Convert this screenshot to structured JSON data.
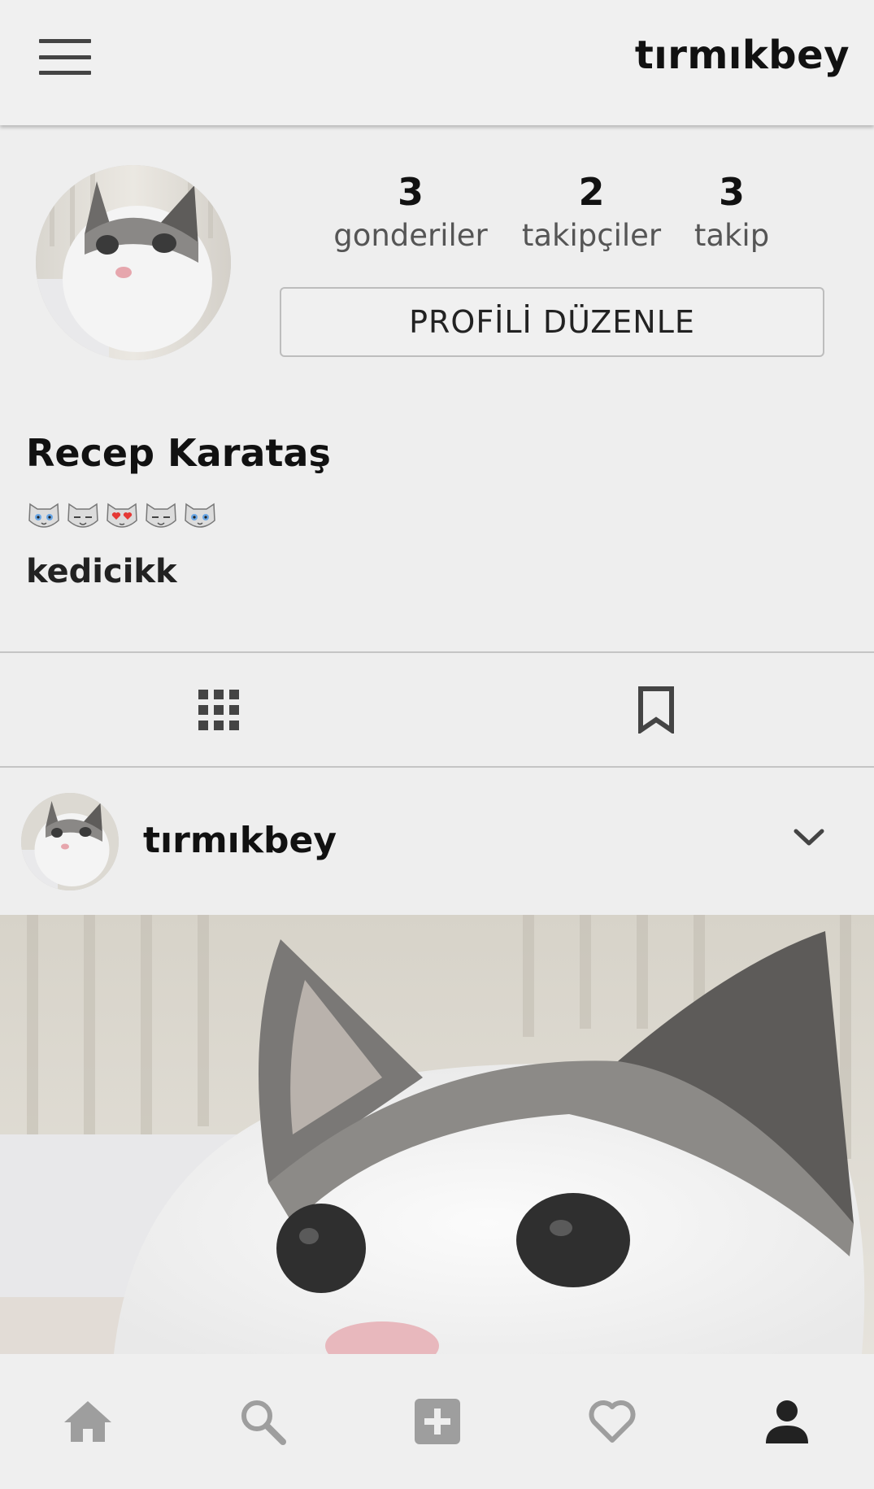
{
  "header": {
    "title": "tırmıkbey"
  },
  "profile": {
    "stats": [
      {
        "value": "3",
        "label": "gonderiler"
      },
      {
        "value": "2",
        "label": "takipçiler"
      },
      {
        "value": "3",
        "label": "takip"
      }
    ],
    "edit_button_label": "PROFİLİ DÜZENLE",
    "full_name": "Recep Karataş",
    "bio_emojis": [
      "cat-face-blue-eyes",
      "cat-face-squint",
      "cat-face-heart-eyes",
      "cat-face-squint",
      "cat-face-blue-eyes"
    ],
    "bio_text": "kedicikk"
  },
  "tabs": {
    "items": [
      {
        "icon": "grid-icon",
        "active": true
      },
      {
        "icon": "bookmark-icon",
        "active": false
      }
    ]
  },
  "post": {
    "username": "tırmıkbey"
  },
  "bottom_nav": {
    "items": [
      {
        "icon": "home-icon",
        "active": false
      },
      {
        "icon": "search-icon",
        "active": false
      },
      {
        "icon": "add-post-icon",
        "active": false
      },
      {
        "icon": "heart-icon",
        "active": false
      },
      {
        "icon": "profile-icon",
        "active": true
      }
    ]
  },
  "colors": {
    "background": "#eeeeee",
    "text_primary": "#111111",
    "text_secondary": "#555555",
    "icon_inactive": "#9e9e9e",
    "icon_active": "#222222",
    "divider": "#c4c4c4"
  }
}
